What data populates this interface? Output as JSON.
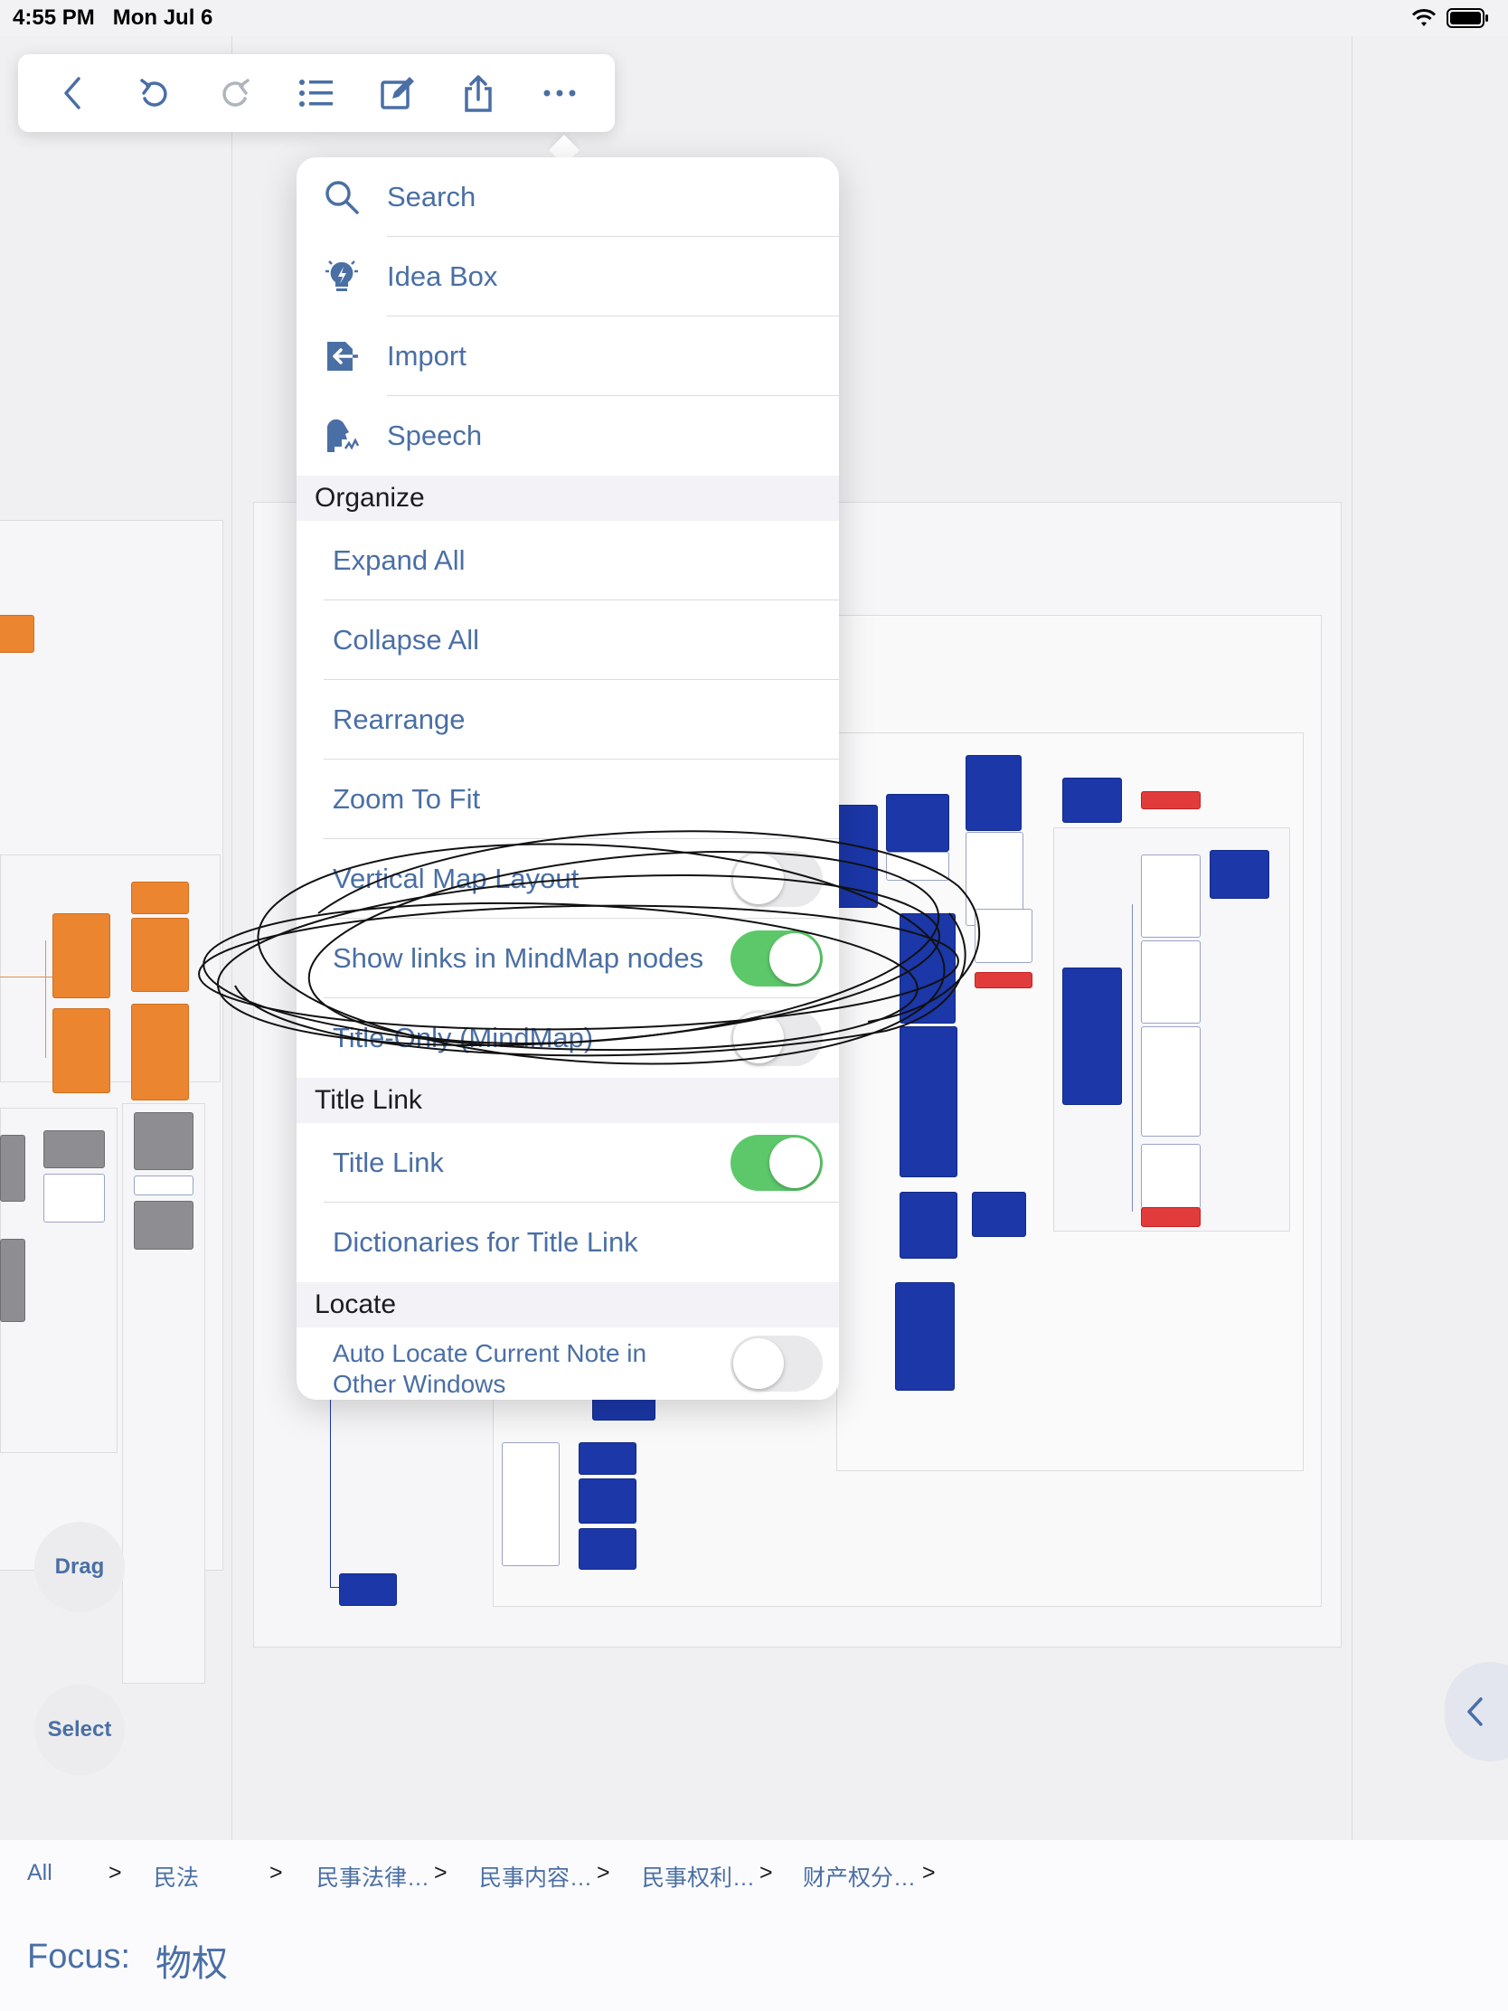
{
  "status": {
    "time": "4:55 PM",
    "date": "Mon Jul 6"
  },
  "toolbar": {
    "buttons": [
      "back-icon",
      "undo-icon",
      "redo-icon",
      "list-icon",
      "edit-icon",
      "share-icon",
      "more-icon"
    ]
  },
  "menu": {
    "items": [
      {
        "label": "Search",
        "icon": "search-icon"
      },
      {
        "label": "Idea Box",
        "icon": "lightbulb-icon"
      },
      {
        "label": "Import",
        "icon": "import-icon"
      },
      {
        "label": "Speech",
        "icon": "speech-icon"
      }
    ],
    "organize": {
      "header": "Organize",
      "items": [
        "Expand All",
        "Collapse All",
        "Rearrange",
        "Zoom To Fit"
      ],
      "toggles": [
        {
          "label": "Vertical Map Layout",
          "on": false
        },
        {
          "label": "Show links in MindMap nodes",
          "on": true
        },
        {
          "label": "Title-Only (MindMap)",
          "on": false
        }
      ]
    },
    "title_link": {
      "header": "Title Link",
      "toggle_label": "Title Link",
      "toggle_on": true,
      "dictionaries_label": "Dictionaries for Title Link"
    },
    "locate": {
      "header": "Locate",
      "auto_locate_line1": "Auto Locate Current Note in",
      "auto_locate_line2": "Other Windows",
      "toggle_on": false
    }
  },
  "side": {
    "drag_label": "Drag",
    "select_label": "Select"
  },
  "breadcrumb": {
    "items": [
      "All",
      "民法",
      "民事法律…",
      "民事内容…",
      "民事权利…",
      "财产权分…"
    ],
    "separator": ">"
  },
  "focus": {
    "label": "Focus:",
    "value": "物权"
  },
  "colors": {
    "accent": "#4a6fa5",
    "toggle_on": "#5cc86a",
    "node_orange": "#ec8530",
    "node_blue": "#1b37a8"
  }
}
